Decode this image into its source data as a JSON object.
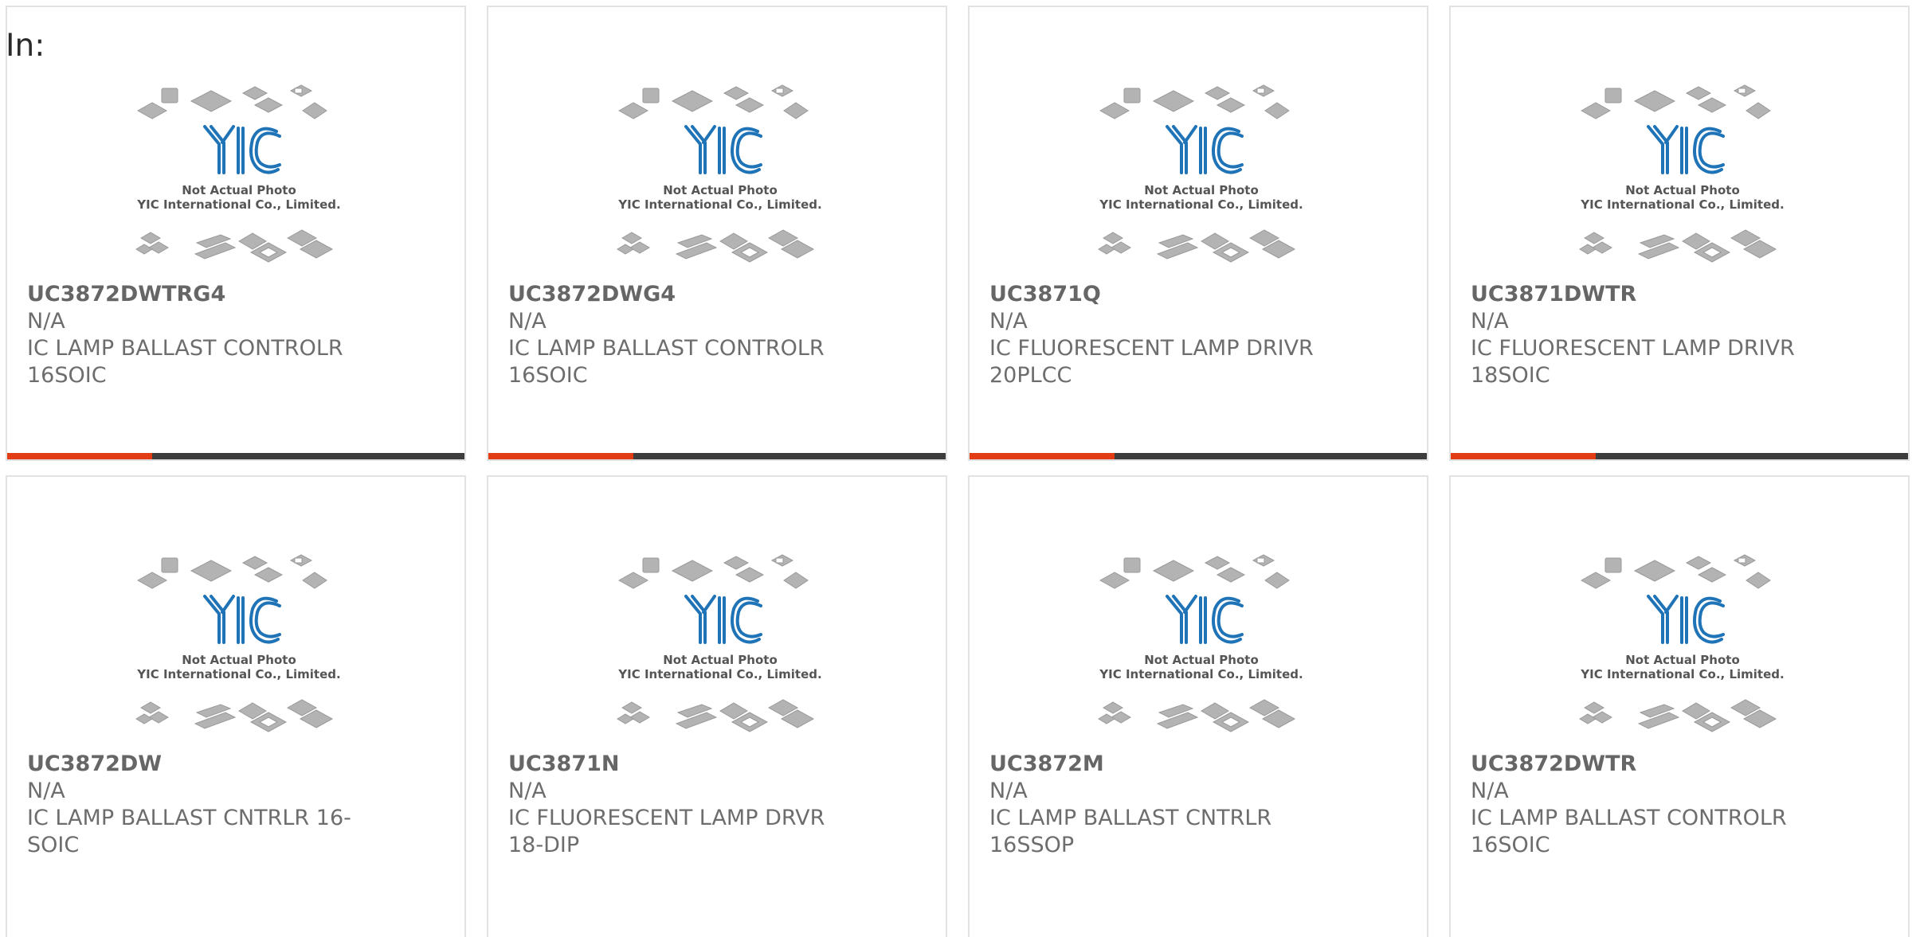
{
  "header": {
    "label": "In:"
  },
  "colors": {
    "accent": "#e23c14",
    "bar": "#3d3d3d",
    "logo": "#1f73b7"
  },
  "thumbnail": {
    "icon": "chip-placeholder-icon",
    "line1": "Not Actual Photo",
    "line2": "YIC International Co., Limited."
  },
  "products": [
    {
      "part": "UC3872DWTRG4",
      "mfr": "N/A",
      "desc": "IC LAMP BALLAST CONTROLR 16SOIC"
    },
    {
      "part": "UC3872DWG4",
      "mfr": "N/A",
      "desc": "IC LAMP BALLAST CONTROLR 16SOIC"
    },
    {
      "part": "UC3871Q",
      "mfr": "N/A",
      "desc": "IC FLUORESCENT LAMP DRIVR 20PLCC"
    },
    {
      "part": "UC3871DWTR",
      "mfr": "N/A",
      "desc": "IC FLUORESCENT LAMP DRIVR 18SOIC"
    },
    {
      "part": "UC3872DW",
      "mfr": "N/A",
      "desc": "IC LAMP BALLAST CNTRLR 16-SOIC"
    },
    {
      "part": "UC3871N",
      "mfr": "N/A",
      "desc": "IC FLUORESCENT LAMP DRVR 18-DIP"
    },
    {
      "part": "UC3872M",
      "mfr": "N/A",
      "desc": "IC LAMP BALLAST CNTRLR 16SSOP"
    },
    {
      "part": "UC3872DWTR",
      "mfr": "N/A",
      "desc": "IC LAMP BALLAST CONTROLR 16SOIC"
    }
  ]
}
